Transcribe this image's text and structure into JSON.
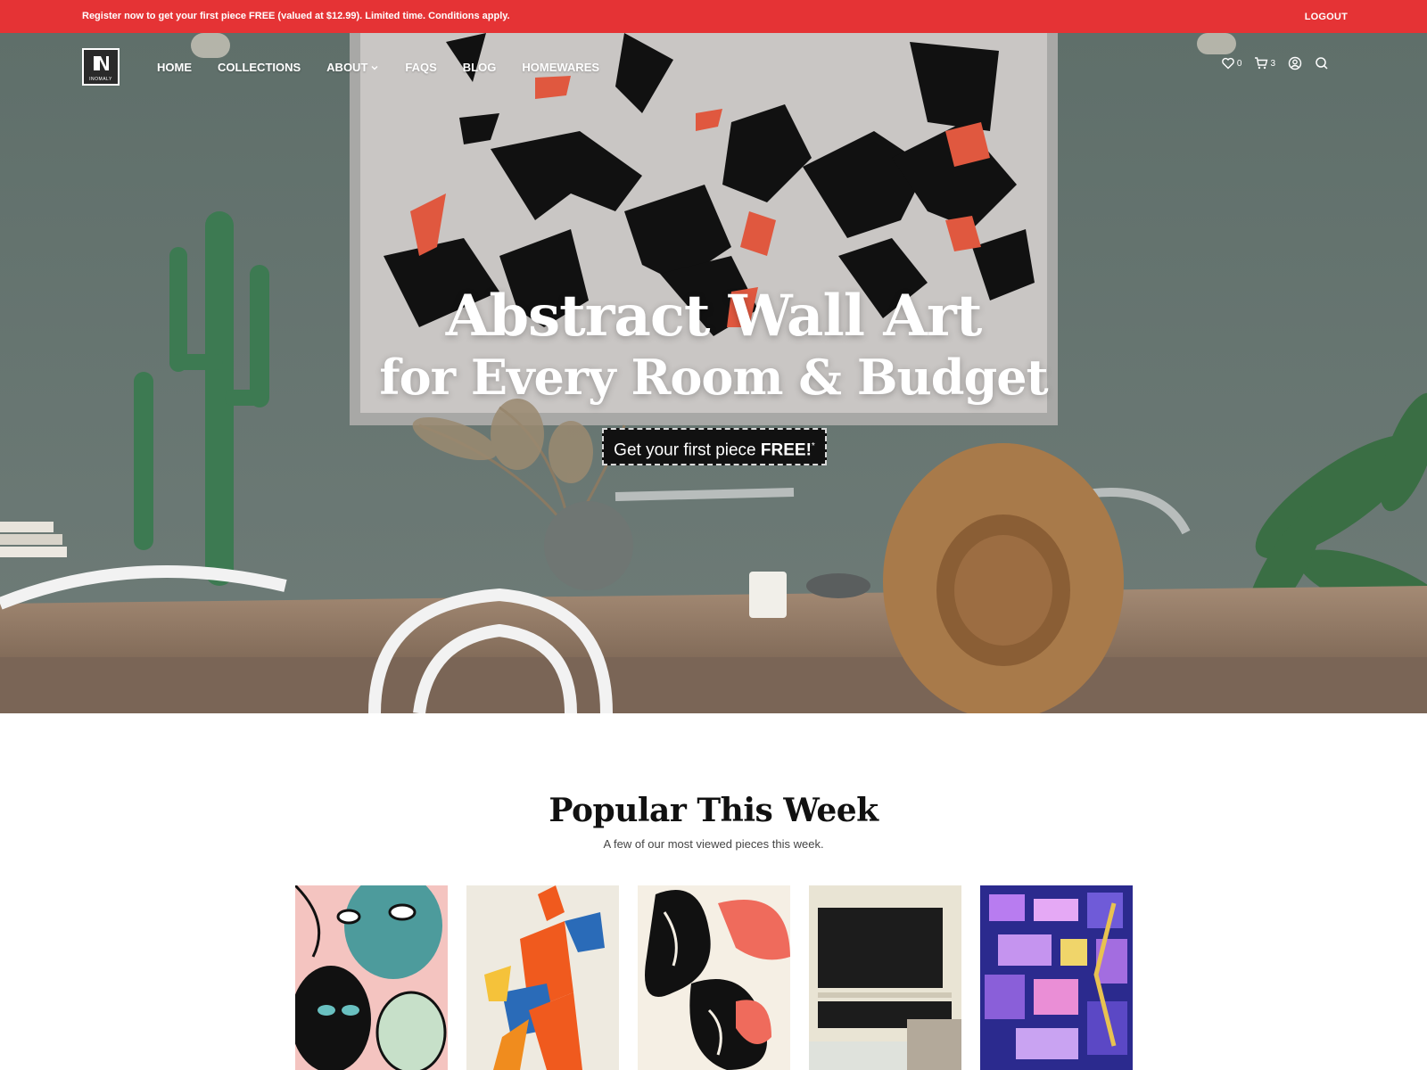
{
  "announcement": {
    "text": "Register now to get your first piece FREE (valued at $12.99). Limited time. Conditions apply.",
    "logout": "LOGOUT",
    "bg_color": "#e53335"
  },
  "brand": {
    "name": "INOMALY",
    "logo_icon": "inomaly-logo"
  },
  "nav": {
    "items": [
      {
        "label": "HOME"
      },
      {
        "label": "COLLECTIONS"
      },
      {
        "label": "ABOUT",
        "has_dropdown": true
      },
      {
        "label": "FAQS"
      },
      {
        "label": "BLOG"
      },
      {
        "label": "HOMEWARES"
      }
    ],
    "wishlist": {
      "icon": "heart-icon",
      "count": "0"
    },
    "cart": {
      "icon": "cart-icon",
      "count": "3"
    },
    "account_icon": "account-icon",
    "search_icon": "search-icon"
  },
  "hero": {
    "title_line1": "Abstract Wall Art",
    "title_line2": "for Every Room & Budget",
    "cta_prefix": "Get your first piece ",
    "cta_emphasis": "FREE!",
    "cta_mark": "*"
  },
  "popular": {
    "title": "Popular This Week",
    "subtitle": "A few of our most viewed pieces this week.",
    "items": [
      {
        "art": "abstract faces illustration"
      },
      {
        "art": "abstract dancer figure"
      },
      {
        "art": "black and white organic shapes"
      },
      {
        "art": "dark brushstroke abstract"
      },
      {
        "art": "purple mosaic collage"
      }
    ]
  }
}
